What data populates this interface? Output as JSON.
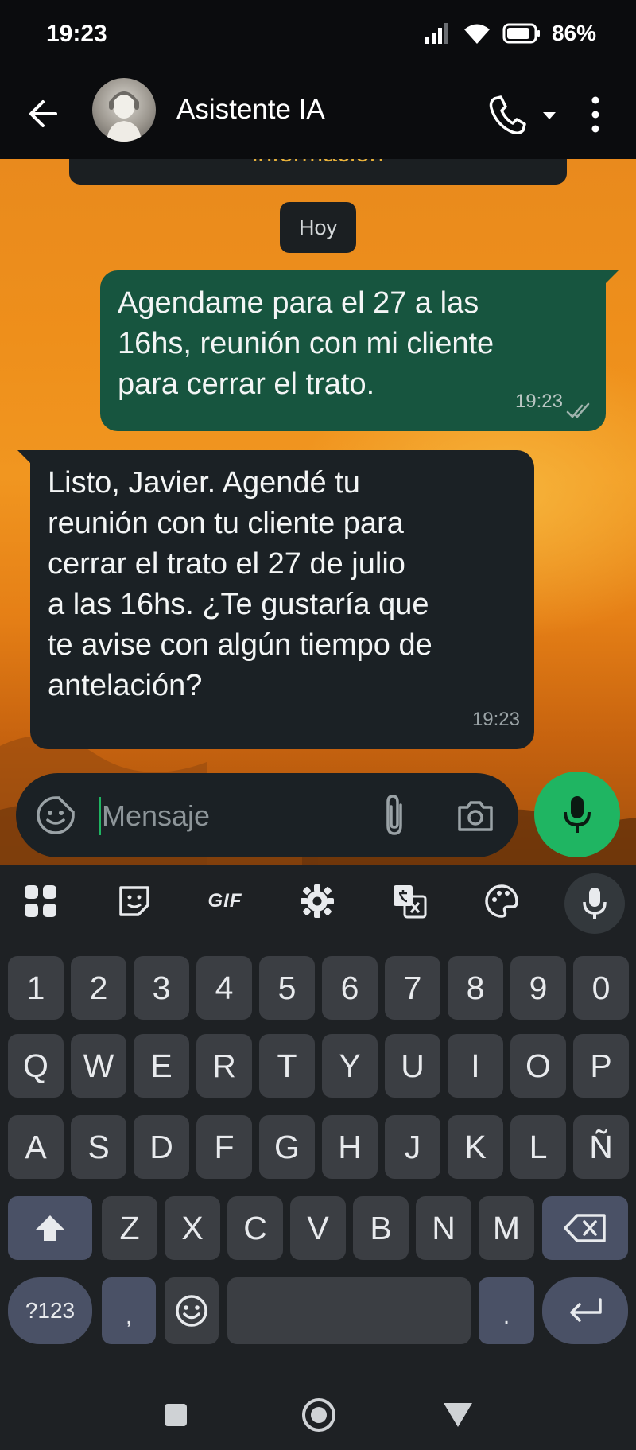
{
  "status_bar": {
    "time": "19:23",
    "battery": "86%"
  },
  "header": {
    "contact_name": "Asistente IA"
  },
  "chat": {
    "previous_message_fragment": "información",
    "date_chip": "Hoy",
    "messages": [
      {
        "direction": "outgoing",
        "text": "Agendame para el 27 a las\n16hs, reunión con mi cliente\npara cerrar el trato.",
        "time": "19:23",
        "status": "read"
      },
      {
        "direction": "incoming",
        "text": "Listo, Javier. Agendé tu\nreunión con tu cliente para\ncerrar el trato el 27 de julio\na las 16hs. ¿Te gustaría que\nte avise con algún tiempo de\nantelación?",
        "time": "19:23"
      }
    ]
  },
  "composer": {
    "placeholder": "Mensaje",
    "value": ""
  },
  "keyboard": {
    "toolbar": {
      "gif_label": "GIF"
    },
    "rows": [
      [
        "1",
        "2",
        "3",
        "4",
        "5",
        "6",
        "7",
        "8",
        "9",
        "0"
      ],
      [
        "Q",
        "W",
        "E",
        "R",
        "T",
        "Y",
        "U",
        "I",
        "O",
        "P"
      ],
      [
        "A",
        "S",
        "D",
        "F",
        "G",
        "H",
        "J",
        "K",
        "L",
        "Ñ"
      ],
      [
        "Z",
        "X",
        "C",
        "V",
        "B",
        "N",
        "M"
      ]
    ],
    "symbols_key": "?123",
    "comma_key": ",",
    "period_key": "."
  },
  "colors": {
    "accent_green": "#1fb562",
    "outgoing_bubble": "#17553f",
    "incoming_bubble": "#1b2125"
  }
}
